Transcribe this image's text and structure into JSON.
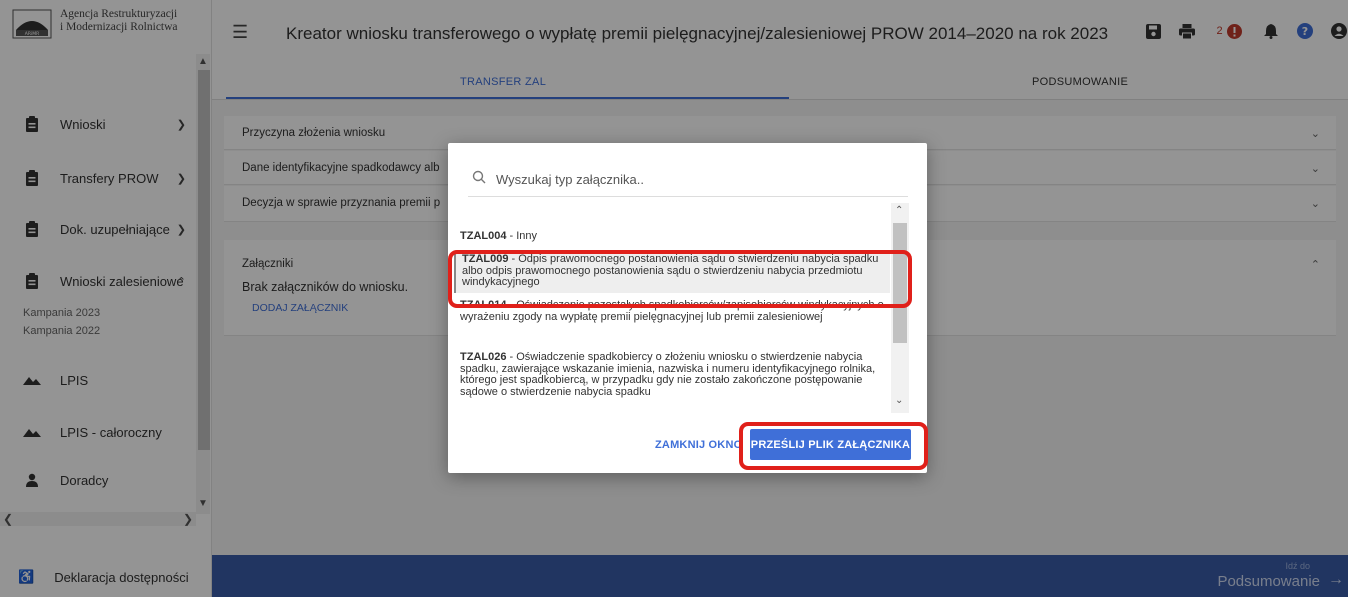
{
  "brand": {
    "line1": "Agencja Restrukturyzacji",
    "line2": "i Modernizacji Rolnictwa",
    "mark_label": "ARiMR"
  },
  "header": {
    "title": "Kreator wniosku transferowego o wypłatę premii pielęgnacyjnej/zalesieniowej PROW 2014–2020 na rok 2023",
    "badge_count": "2"
  },
  "tabs": [
    {
      "label": "TRANSFER ZAL",
      "active": true
    },
    {
      "label": "PODSUMOWANIE",
      "active": false
    }
  ],
  "sidebar": {
    "items": [
      {
        "label": "Wnioski",
        "icon": "clipboard-icon"
      },
      {
        "label": "Transfery PROW",
        "icon": "clipboard-icon"
      },
      {
        "label": "Dok. uzupełniające",
        "icon": "clipboard-icon"
      },
      {
        "label": "Wnioski zalesieniowe",
        "icon": "clipboard-icon"
      },
      {
        "label": "LPIS",
        "icon": "mountain-icon"
      },
      {
        "label": "LPIS - całoroczny",
        "icon": "mountain-icon"
      },
      {
        "label": "Doradcy",
        "icon": "person-icon"
      }
    ],
    "sub_items": [
      "Kampania 2023",
      "Kampania 2022"
    ],
    "footer_item": "Deklaracja dostępności"
  },
  "panels": [
    {
      "label": "Przyczyna złożenia wniosku"
    },
    {
      "label": "Dane identyfikacyjne spadkodawcy alb"
    },
    {
      "label": "Decyzja w sprawie przyznania premii p"
    }
  ],
  "attachments": {
    "title": "Załączniki",
    "empty_text": "Brak załączników do wniosku.",
    "add_button": "DODAJ ZAŁĄCZNIK"
  },
  "footer": {
    "goto_label": "Idź do",
    "goto_target": "Podsumowanie"
  },
  "modal": {
    "search_placeholder": "Wyszukaj typ załącznika..",
    "options": [
      {
        "code": "TZAL004",
        "text": " - Inny"
      },
      {
        "code": "TZAL009",
        "text": " - Odpis prawomocnego postanowienia sądu o stwierdzeniu nabycia spadku albo odpis prawomocnego postanowienia sądu o stwierdzeniu nabycia przedmiotu windykacyjnego",
        "selected": true
      },
      {
        "code": "TZAL014",
        "text": " - Oświadczenie pozostałych spadkobierców/zapisobierców windykacyjnych o wyrażeniu zgody na wypłatę premii pielęgnacyjnej lub premii zalesieniowej"
      },
      {
        "code": "TZAL026",
        "text": " - Oświadczenie spadkobiercy o złożeniu wniosku o stwierdzenie nabycia spadku, zawierające wskazanie imienia, nazwiska i numeru identyfikacyjnego rolnika, którego jest spadkobiercą, w przypadku gdy nie zostało zakończone postępowanie sądowe o stwierdzenie nabycia spadku"
      }
    ],
    "close_label": "ZAMKNIJ OKNO",
    "send_label": "PRZEŚLIJ PLIK ZAŁĄCZNIKA"
  },
  "colors": {
    "accent": "#3f6fd8",
    "footer_bg": "#3a5ca8",
    "highlight": "#e0201a",
    "alert": "#c0392b"
  }
}
